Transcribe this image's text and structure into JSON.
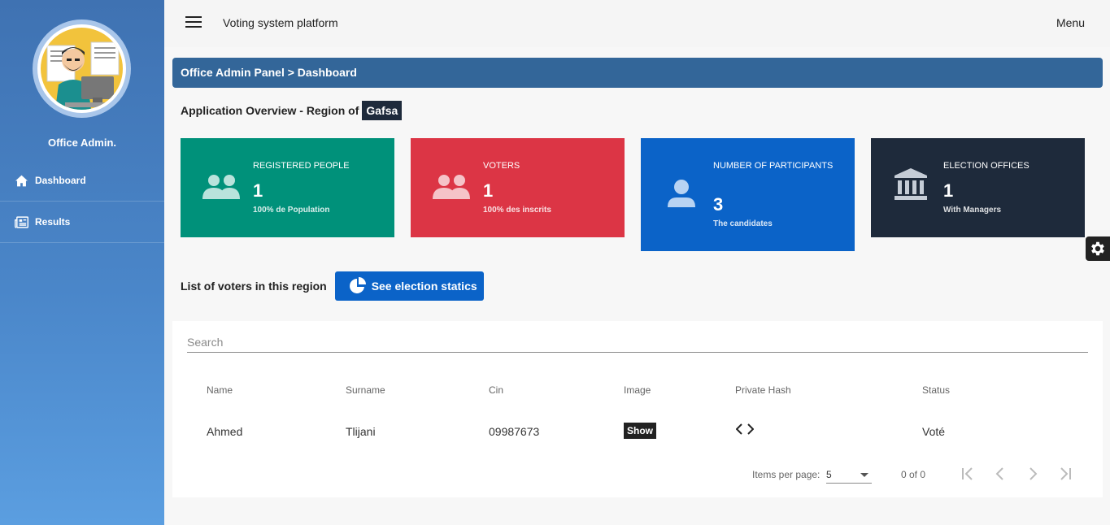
{
  "sidebar": {
    "admin_name": "Office Admin.",
    "items": [
      {
        "label": "Dashboard",
        "icon": "home-icon"
      },
      {
        "label": "Results",
        "icon": "newspaper-icon"
      }
    ]
  },
  "topbar": {
    "title": "Voting system platform",
    "menu_label": "Menu"
  },
  "breadcrumb": "Office Admin Panel > Dashboard",
  "overview": {
    "prefix": "Application Overview - Region of",
    "region": "Gafsa"
  },
  "cards": [
    {
      "label": "REGISTERED PEOPLE",
      "value": "1",
      "sub": "100% de Population",
      "color": "#00917a",
      "icon": "people-icon"
    },
    {
      "label": "VOTERS",
      "value": "1",
      "sub": "100% des inscrits",
      "color": "#dc3545",
      "icon": "people-icon"
    },
    {
      "label": "NUMBER OF PARTICIPANTS",
      "value": "3",
      "sub": "The candidates",
      "color": "#0b63c8",
      "icon": "person-icon"
    },
    {
      "label": "ELECTION OFFICES",
      "value": "1",
      "sub": "With Managers",
      "color": "#1e2a3b",
      "icon": "bank-icon"
    }
  ],
  "voters": {
    "title": "List of voters in this region",
    "stats_button": "See election statics"
  },
  "table": {
    "search_placeholder": "Search",
    "headers": [
      "Name",
      "Surname",
      "Cin",
      "Image",
      "Private Hash",
      "Status"
    ],
    "rows": [
      {
        "name": "Ahmed",
        "surname": "Tlijani",
        "cin": "09987673",
        "image": "Show",
        "status": "Voté"
      }
    ],
    "pagination": {
      "items_per_page_label": "Items per page:",
      "items_per_page": "5",
      "range": "0 of 0"
    }
  },
  "colors": {
    "sidebar": "#4a86c9",
    "breadcrumb": "#336699",
    "button": "#0b63c8"
  }
}
